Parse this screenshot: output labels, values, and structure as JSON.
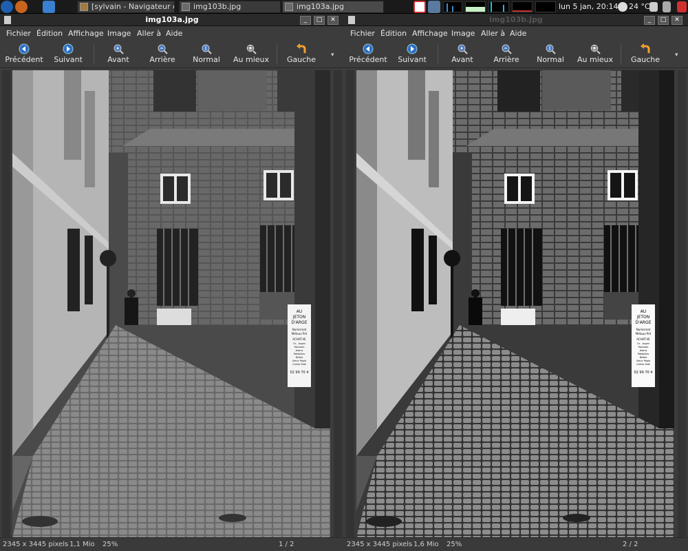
{
  "panel": {
    "tasks": [
      {
        "label": "[sylvain - Navigateur d..."
      },
      {
        "label": "img103b.jpg"
      },
      {
        "label": "img103a.jpg"
      }
    ],
    "clock": "lun  5 jan, 20:14",
    "weather": "24 °C"
  },
  "windows": [
    {
      "title": "img103a.jpg",
      "menu": [
        "Fichier",
        "Édition",
        "Affichage",
        "Image",
        "Aller à",
        "Aide"
      ],
      "toolbar": [
        "Précédent",
        "Suivant",
        "Avant",
        "Arrière",
        "Normal",
        "Au mieux",
        "Gauche"
      ],
      "status": {
        "dims": "2345 x 3445 pixels",
        "size": "1,1 Mio",
        "zoom": "25%",
        "page": "1 / 2"
      }
    },
    {
      "title": "img103b.jpg",
      "menu": [
        "Fichier",
        "Édition",
        "Affichage",
        "Image",
        "Aller à",
        "Aide"
      ],
      "toolbar": [
        "Précédent",
        "Suivant",
        "Avant",
        "Arrière",
        "Normal",
        "Au mieux",
        "Gauche"
      ],
      "status": {
        "dims": "2345 x 3445 pixels",
        "size": "1,6 Mio",
        "zoom": "25%",
        "page": "2 / 2"
      }
    }
  ],
  "photo": {
    "sign_text": [
      "AU",
      "JETON",
      "D'ARGE",
      "Numismat",
      "Métaux Pré",
      "ACHAT-VE",
      "Or - Argen",
      "Monnaie",
      "Jetons",
      "Médailles",
      "Billets",
      "Vieux Papie",
      "Cartes Post",
      "02 99 70 4"
    ]
  },
  "icons": {
    "prev": "go-previous-icon",
    "next": "go-next-icon",
    "zoom_in": "zoom-in-icon",
    "zoom_out": "zoom-out-icon",
    "zoom_normal": "zoom-original-icon",
    "zoom_fit": "zoom-fit-icon",
    "rotate_left": "rotate-left-icon"
  },
  "colors": {
    "panel_bg": "#1a1a1a",
    "window_bg": "#3c3c3c",
    "nav_blue": "#2f6fc7",
    "rotate_orange": "#f0a030"
  }
}
